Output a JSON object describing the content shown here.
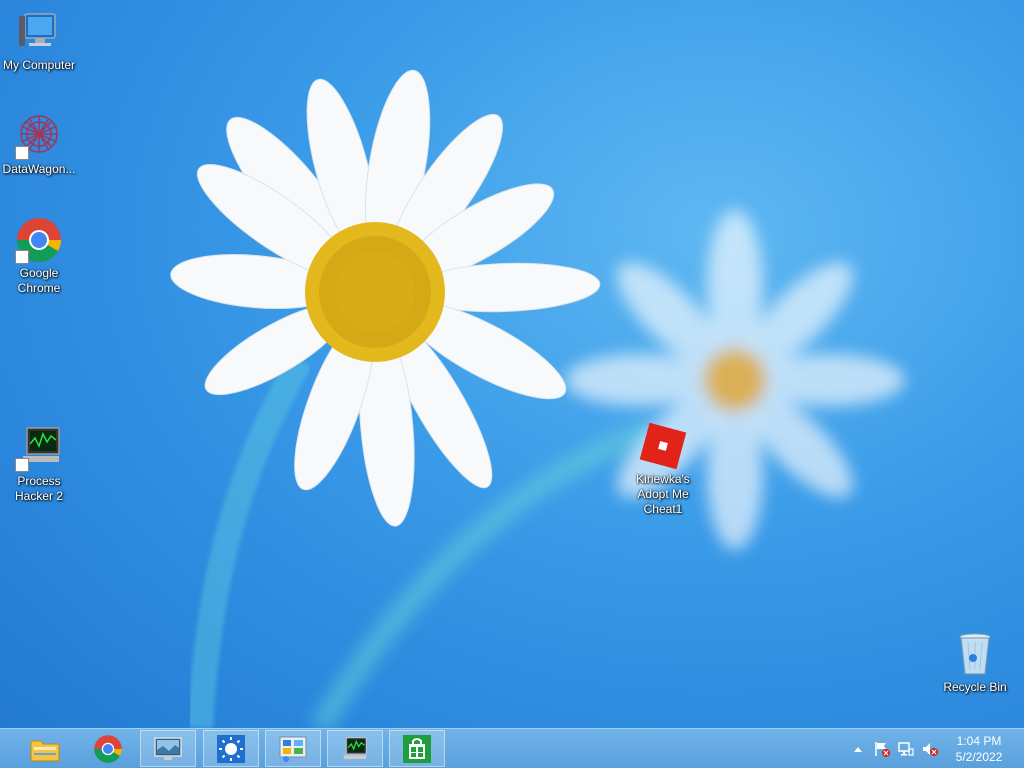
{
  "desktop": {
    "icons": [
      {
        "label": "My Computer",
        "icon": "computer-icon"
      },
      {
        "label": "DataWagon...",
        "icon": "datawagon-icon"
      },
      {
        "label": "Google Chrome",
        "icon": "chrome-icon"
      },
      {
        "label": "Process Hacker 2",
        "icon": "process-hacker-icon"
      },
      {
        "label": "Kiriewka's Adopt Me Cheat1",
        "icon": "roblox-icon"
      },
      {
        "label": "Recycle Bin",
        "icon": "recycle-bin-icon"
      }
    ]
  },
  "taskbar": {
    "buttons": [
      {
        "name": "File Explorer",
        "icon": "folder-icon"
      },
      {
        "name": "Google Chrome",
        "icon": "chrome-icon"
      },
      {
        "name": "Screen",
        "icon": "monitor-icon"
      },
      {
        "name": "Weather",
        "icon": "sun-icon"
      },
      {
        "name": "Control Panel",
        "icon": "control-panel-icon"
      },
      {
        "name": "Process Hacker",
        "icon": "process-hacker-icon"
      },
      {
        "name": "Store",
        "icon": "store-icon"
      }
    ],
    "tray": {
      "icons": [
        "chevron-up-icon",
        "action-center-flag-icon",
        "network-icon",
        "volume-muted-icon"
      ]
    },
    "clock": {
      "time": "1:04 PM",
      "date": "5/2/2022"
    }
  },
  "colors": {
    "desktop_bg": "#3a9be8",
    "taskbar_bg": "#5aa0dc",
    "roblox_red": "#e2231a"
  }
}
